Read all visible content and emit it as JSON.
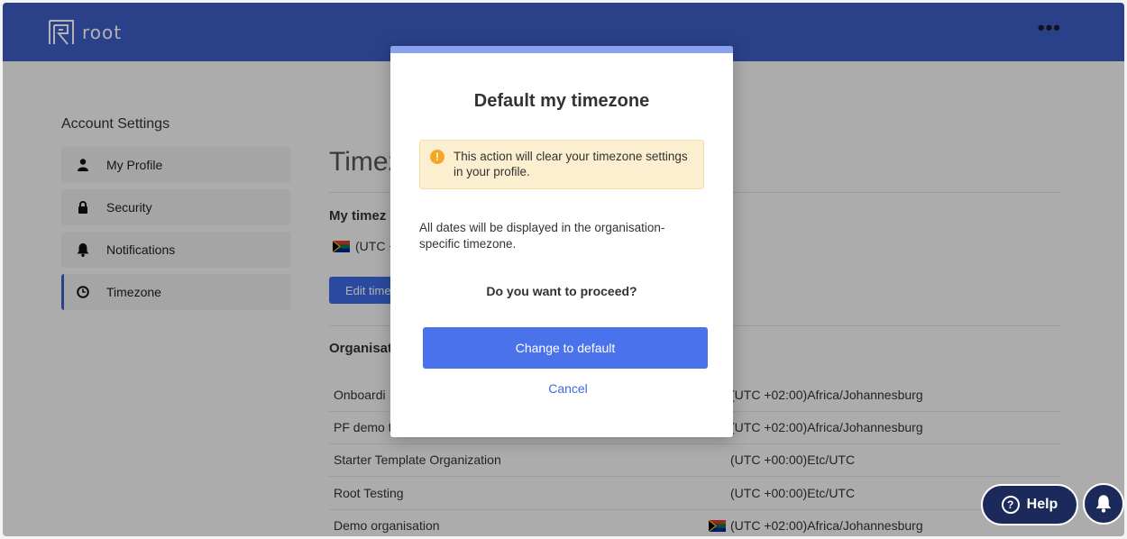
{
  "header": {
    "app_name": "root",
    "menu_label": "•••",
    "brand_color": "#3d5cc3"
  },
  "sidebar": {
    "title": "Account Settings",
    "items": [
      {
        "label": "My Profile",
        "icon": "user-icon"
      },
      {
        "label": "Security",
        "icon": "lock-icon"
      },
      {
        "label": "Notifications",
        "icon": "bell-icon"
      },
      {
        "label": "Timezone",
        "icon": "clock-icon",
        "active": true
      }
    ]
  },
  "main": {
    "title": "Timez",
    "my_timezone_title": "My timez",
    "my_timezone_value": "(UTC +",
    "edit_button": "Edit time",
    "org_title": "Organisat",
    "org_rows": [
      {
        "name": "Onboardi",
        "timezone": "(UTC +02:00)Africa/Johannesburg",
        "flag": false
      },
      {
        "name": "PF demo t",
        "timezone": "(UTC +02:00)Africa/Johannesburg",
        "flag": false
      },
      {
        "name": "Starter Template Organization",
        "timezone": "(UTC +00:00)Etc/UTC",
        "flag": false
      },
      {
        "name": "Root Testing",
        "timezone": "(UTC +00:00)Etc/UTC",
        "flag": false
      },
      {
        "name": "Demo organisation",
        "timezone": "(UTC +02:00)Africa/Johannesburg",
        "flag": true
      }
    ]
  },
  "modal": {
    "title": "Default my timezone",
    "warning": "This action will clear your timezone settings in your profile.",
    "warning_icon": "!",
    "body": "All dates will be displayed in the organisation-specific timezone.",
    "question": "Do you want to proceed?",
    "primary_label": "Change to default",
    "cancel_label": "Cancel"
  },
  "floating": {
    "help_label": "Help",
    "help_icon": "?"
  },
  "colors": {
    "primary": "#4a72ea",
    "warning_bg": "#fcefd0",
    "warning_icon": "#f5a623",
    "help_bg": "#1b2a5a"
  }
}
